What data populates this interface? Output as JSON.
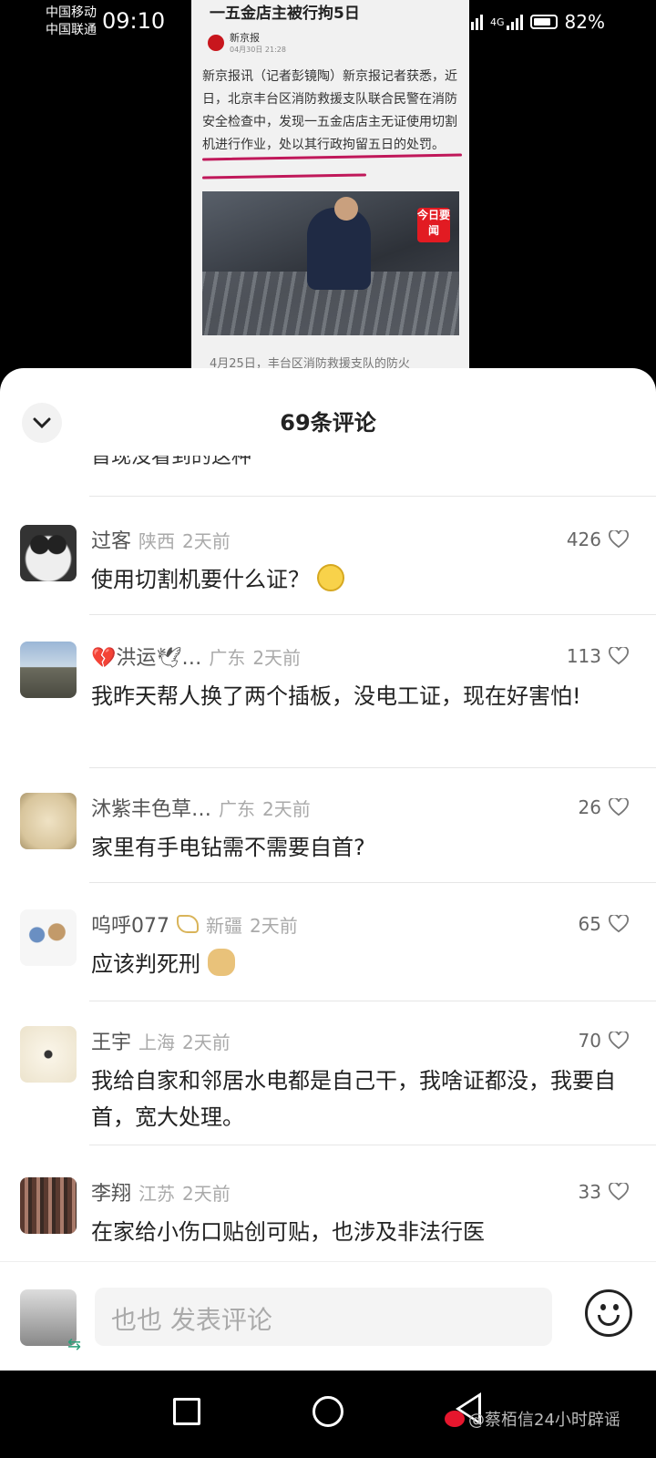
{
  "status_bar": {
    "carrier1": "中国移动",
    "carrier2": "中国联通",
    "time": "09:10",
    "network": "4G",
    "battery": "82%"
  },
  "article": {
    "headline": "一五金店主被行拘5日",
    "source": "新京报",
    "date": "04月30日 21:28",
    "body": "新京报讯（记者彭镜陶）新京报记者获悉，近日，北京丰台区消防救援支队联合民警在消防安全检查中，发现一五金店店主无证使用切割机进行作业，处以其行政拘留五日的处罚。",
    "photo_badge": "今日要闻",
    "next_line": "4月25日，丰台区消防救援支队的防火"
  },
  "sheet": {
    "title": "69条评论",
    "cutoff_text": "首现没看到的这种"
  },
  "comments": [
    {
      "user": "过客",
      "location": "陕西",
      "time": "2天前",
      "likes": "426",
      "text": "使用切割机要什么证？"
    },
    {
      "user": "💔洪运🕊…",
      "location": "广东",
      "time": "2天前",
      "likes": "113",
      "text": "我昨天帮人换了两个插板，没电工证，现在好害怕!"
    },
    {
      "user": "沐紫丰色草…",
      "location": "广东",
      "time": "2天前",
      "likes": "26",
      "text": "家里有手电钻需不需要自首?"
    },
    {
      "user": "呜呼077",
      "location": "新疆",
      "time": "2天前",
      "likes": "65",
      "text": "应该判死刑"
    },
    {
      "user": "王宇",
      "location": "上海",
      "time": "2天前",
      "likes": "70",
      "text": "我给自家和邻居水电都是自己干，我啥证都没，我要自首，宽大处理。"
    },
    {
      "user": "李翔",
      "location": "江苏",
      "time": "2天前",
      "likes": "33",
      "text": "在家给小伤口贴创可贴，也涉及非法行医"
    }
  ],
  "input_bar": {
    "placeholder": "也也 发表评论",
    "swap_icon": "⇆"
  },
  "watermark": {
    "text": "@蔡栢信24小时辟谣"
  },
  "colors": {
    "highlight_line": "#c0185a",
    "news_logo": "#c8161d",
    "sheet_bg": "#ffffff",
    "weibo_red": "#e6162d"
  }
}
